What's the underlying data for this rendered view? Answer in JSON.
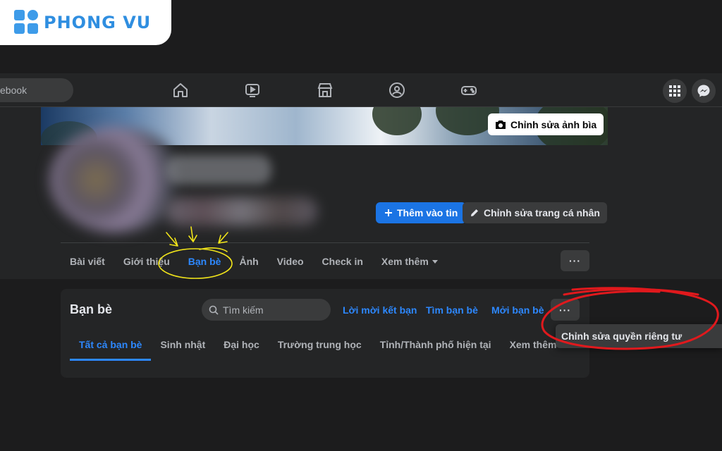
{
  "watermark": {
    "brand": "PHONG VU",
    "color": "#2f8ee0"
  },
  "topbar": {
    "search_text": "ebook",
    "nav_icons": [
      "home-icon",
      "watch-icon",
      "marketplace-icon",
      "groups-icon",
      "gaming-icon"
    ],
    "right_icons": [
      "menu-grid-icon",
      "messenger-icon"
    ]
  },
  "profile": {
    "edit_cover_label": "Chỉnh sửa ảnh bìa",
    "add_story_label": "Thêm vào tin",
    "edit_profile_label": "Chỉnh sửa trang cá nhân",
    "tabs": [
      {
        "label": "Bài viết",
        "active": false
      },
      {
        "label": "Giới thiệu",
        "active": false
      },
      {
        "label": "Bạn bè",
        "active": true
      },
      {
        "label": "Ảnh",
        "active": false
      },
      {
        "label": "Video",
        "active": false
      },
      {
        "label": "Check in",
        "active": false
      },
      {
        "label": "Xem thêm",
        "active": false,
        "dropdown": true
      }
    ],
    "more_label": "···"
  },
  "friends": {
    "title": "Bạn bè",
    "search_placeholder": "Tìm kiếm",
    "links": [
      "Lời mời kết bạn",
      "Tìm bạn bè",
      "Mởi bạn bè"
    ],
    "more_label": "···",
    "subtabs": [
      {
        "label": "Tất cả bạn bè",
        "active": true
      },
      {
        "label": "Sinh nhật",
        "active": false
      },
      {
        "label": "Đại học",
        "active": false
      },
      {
        "label": "Trường trung học",
        "active": false
      },
      {
        "label": "Tỉnh/Thành phố hiện tại",
        "active": false
      },
      {
        "label": "Xem thêm",
        "active": false,
        "dropdown": true
      }
    ],
    "popup_item": "Chỉnh sửa quyền riêng tư"
  },
  "colors": {
    "accent": "#2d88ff",
    "primary_button": "#1b74e4",
    "annotation_red": "#e0191d",
    "annotation_yellow": "#f2e51a"
  }
}
